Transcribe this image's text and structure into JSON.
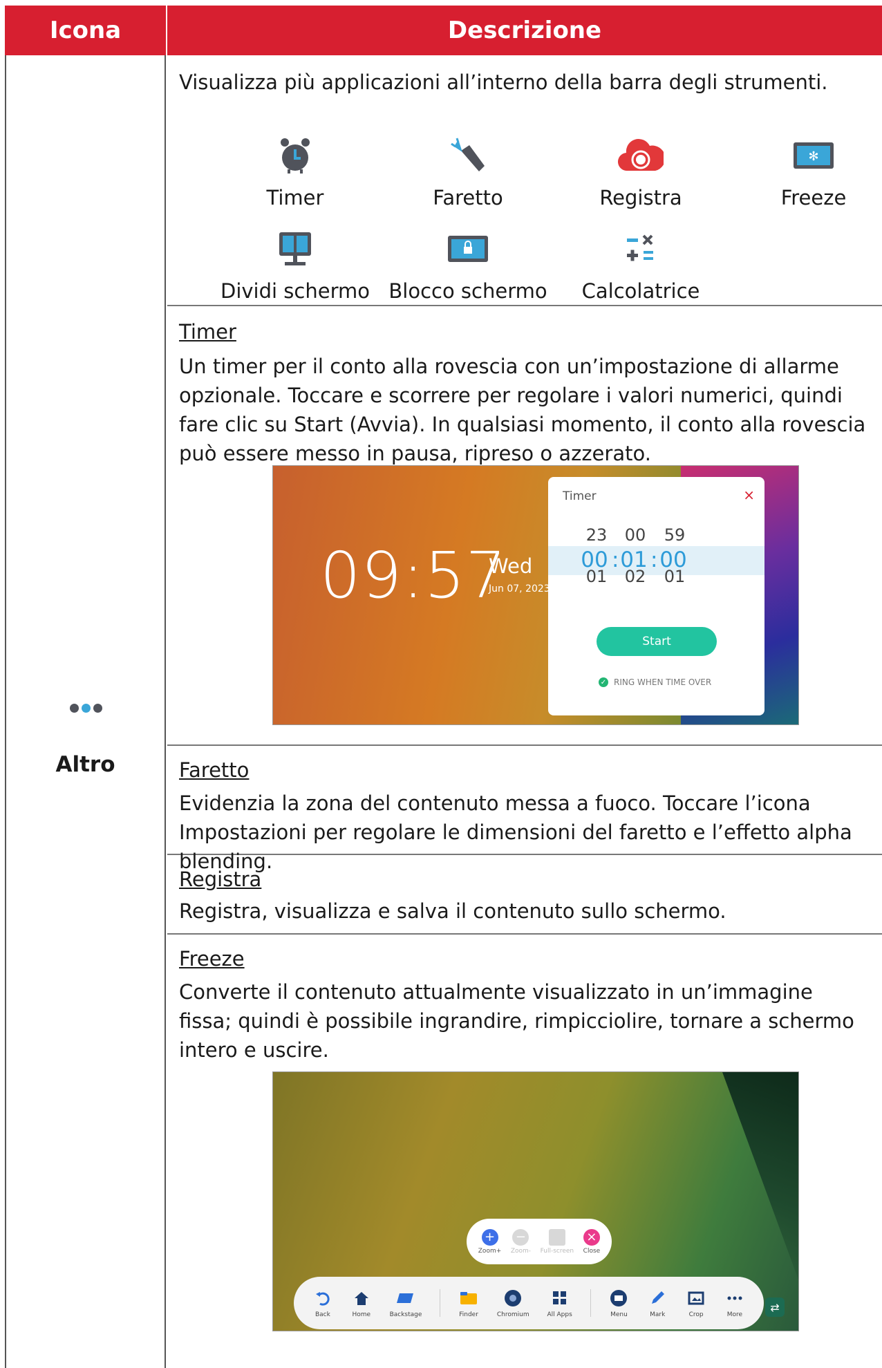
{
  "header": {
    "icon_col": "Icona",
    "desc_col": "Descrizione"
  },
  "left": {
    "label": "Altro",
    "icon": "more-dots-icon"
  },
  "overview": {
    "text": "Visualizza più applicazioni all’interno della barra degli strumenti.",
    "items": [
      {
        "label": "Timer",
        "icon": "alarm-clock-icon"
      },
      {
        "label": "Faretto",
        "icon": "flashlight-icon"
      },
      {
        "label": "Registra",
        "icon": "record-cloud-icon"
      },
      {
        "label": "Freeze",
        "icon": "snowflake-screen-icon"
      },
      {
        "label": "Dividi schermo",
        "icon": "split-screen-icon"
      },
      {
        "label": "Blocco schermo",
        "icon": "lock-screen-icon"
      },
      {
        "label": "Calcolatrice",
        "icon": "calculator-icon"
      }
    ]
  },
  "timer": {
    "title": "Timer",
    "body": "Un timer per il conto alla rovescia con un’impostazione di allarme opzionale. Toccare e scorrere per regolare i valori numerici, quindi fare clic su Start (Avvia). In qualsiasi momento, il conto alla rovescia può essere messo in pausa, ripreso o azzerato.",
    "screen": {
      "clock": "09:57",
      "day": "Wed",
      "date": "Jun 07, 2023",
      "dialog_title": "Timer",
      "close": "×",
      "prev": [
        "23",
        "00",
        "59"
      ],
      "current": [
        "00",
        "01",
        "00"
      ],
      "next": [
        "01",
        "02",
        "01"
      ],
      "sep": ":",
      "start": "Start",
      "ring": "RING WHEN TIME OVER"
    }
  },
  "faretto": {
    "title": "Faretto",
    "body": "Evidenzia la zona del contenuto messa a fuoco. Toccare l’icona Impostazioni per regolare le dimensioni del faretto e l’effetto alpha blending."
  },
  "registra": {
    "title": "Registra",
    "body": "Registra, visualizza e salva il contenuto sullo schermo."
  },
  "freeze": {
    "title": "Freeze",
    "body": "Converte il contenuto attualmente visualizzato in un’immagine fissa; quindi è possibile ingrandire, rimpicciolire, tornare a schermo intero e uscire.",
    "screen": {
      "zoom": [
        "Zoom+",
        "Zoom-",
        "Full-screen",
        "Close"
      ],
      "toolbar": [
        "Back",
        "Home",
        "Backstage",
        "Finder",
        "Chromium",
        "All Apps",
        "Menu",
        "Mark",
        "Crop",
        "More"
      ]
    }
  }
}
